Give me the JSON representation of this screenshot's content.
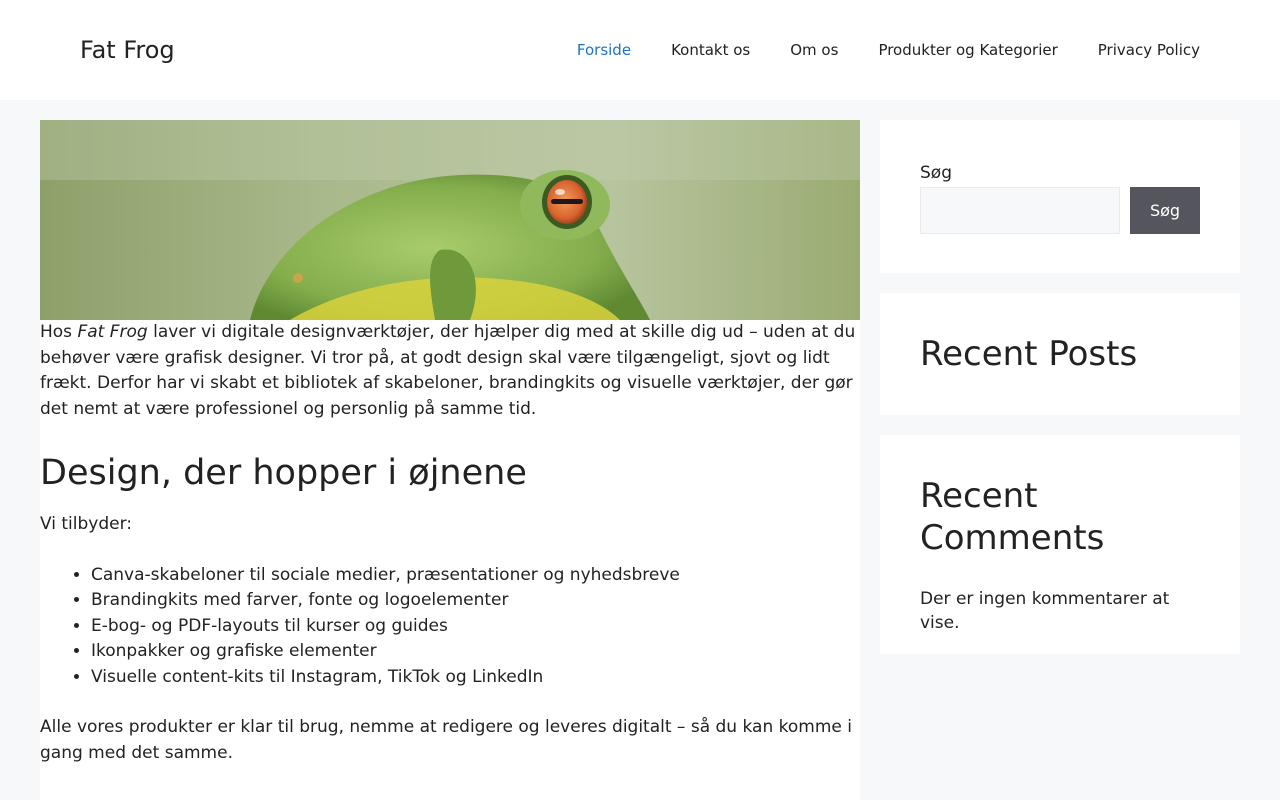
{
  "header": {
    "site_title": "Fat Frog",
    "nav": [
      {
        "label": "Forside",
        "current": true
      },
      {
        "label": "Kontakt os",
        "current": false
      },
      {
        "label": "Om os",
        "current": false
      },
      {
        "label": "Produkter og Kategorier",
        "current": false
      },
      {
        "label": "Privacy Policy",
        "current": false
      }
    ]
  },
  "article": {
    "intro_prefix": "Hos ",
    "intro_brand": "Fat Frog",
    "intro_rest": " laver vi digitale designværktøjer, der hjælper dig med at skille dig ud – uden at du behøver være grafisk designer. Vi tror på, at godt design skal være tilgængeligt, sjovt og lidt frækt. Derfor har vi skabt et bibliotek af skabeloner, brandingkits og visuelle værktøjer, der gør det nemt at være professionel og personlig på samme tid.",
    "heading": "Design, der hopper i øjnene",
    "offer_lead": "Vi tilbyder:",
    "offers": [
      "Canva-skabeloner til sociale medier, præsentationer og nyhedsbreve",
      "Brandingkits med farver, fonte og logoelementer",
      "E-bog- og PDF-layouts til kurser og guides",
      "Ikonpakker og grafiske elementer",
      "Visuelle content-kits til Instagram, TikTok og LinkedIn"
    ],
    "closing": "Alle vores produkter er klar til brug, nemme at redigere og leveres digitalt – så du kan komme i gang med det samme."
  },
  "sidebar": {
    "search_label": "Søg",
    "search_value": "",
    "search_button": "Søg",
    "recent_posts_title": "Recent Posts",
    "recent_comments_title": "Recent Comments",
    "no_comments": "Der er ingen kommentarer at vise."
  },
  "colors": {
    "link_active": "#1e73be",
    "page_bg": "#f7f8f9",
    "button_bg": "#55555e"
  }
}
